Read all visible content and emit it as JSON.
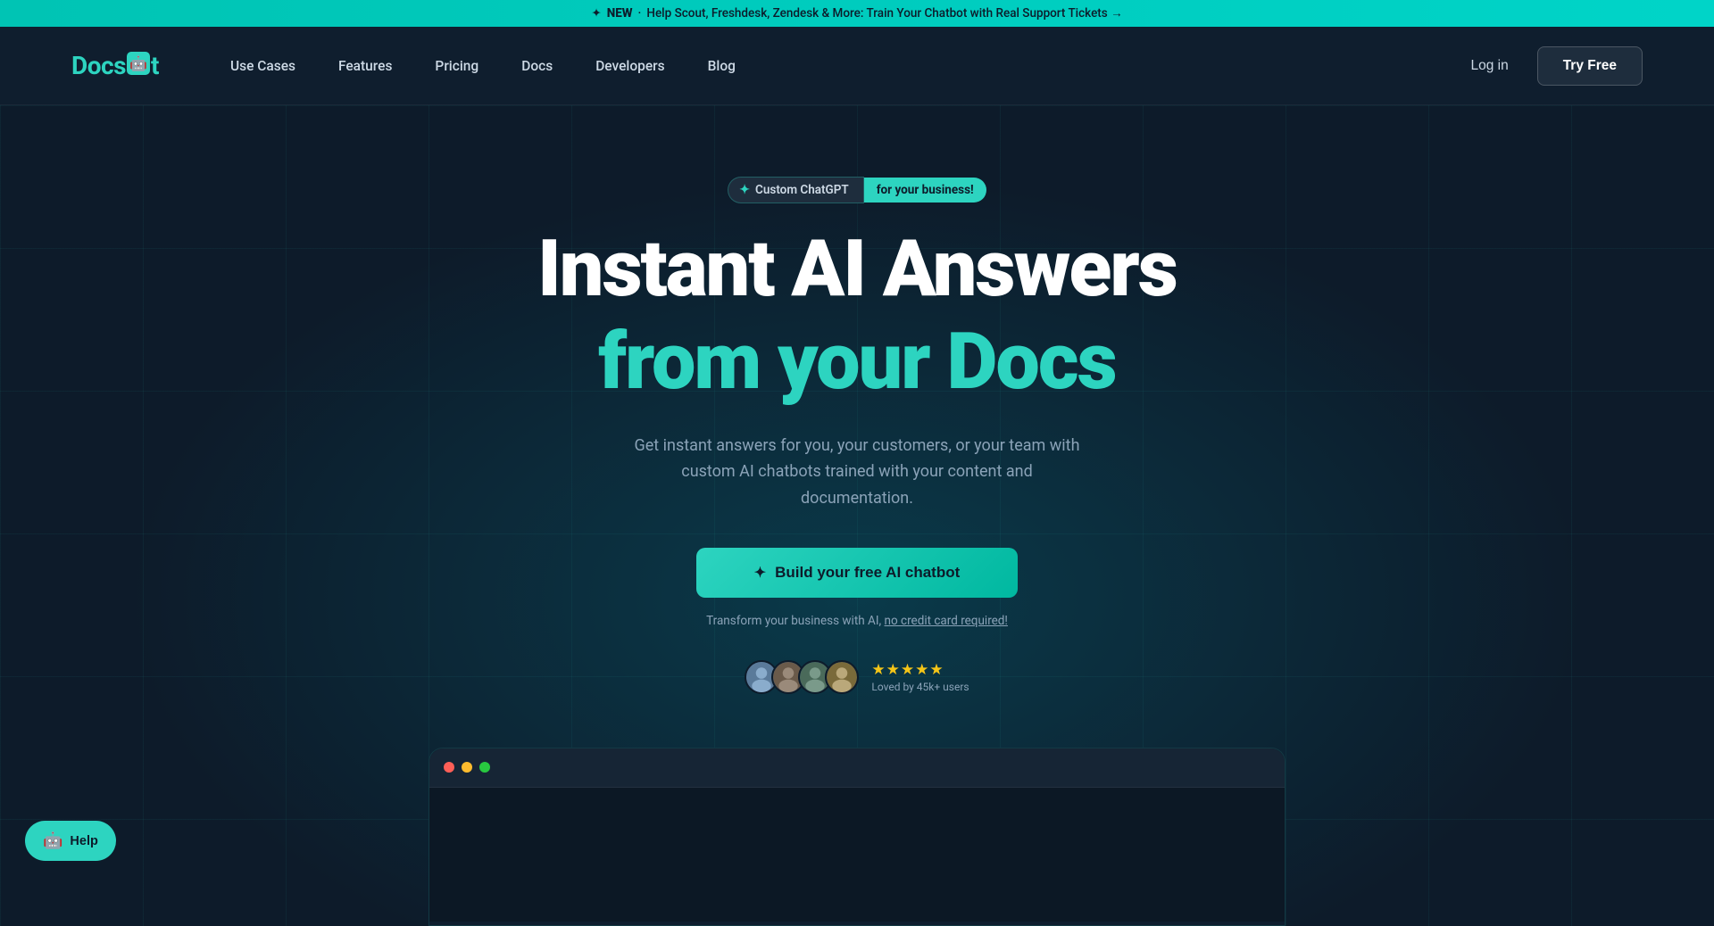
{
  "announcement": {
    "new_label": "NEW",
    "separator": "·",
    "text": "Help Scout, Freshdesk, Zendesk & More: Train Your Chatbot with Real Support Tickets →",
    "link_text": "Help Scout, Freshdesk, Zendesk & More: Train Your Chatbot with Real Support Tickets →"
  },
  "navbar": {
    "logo_text_before": "Docs",
    "logo_text_after": "t",
    "links": [
      {
        "label": "Use Cases",
        "id": "use-cases"
      },
      {
        "label": "Features",
        "id": "features"
      },
      {
        "label": "Pricing",
        "id": "pricing"
      },
      {
        "label": "Docs",
        "id": "docs"
      },
      {
        "label": "Developers",
        "id": "developers"
      },
      {
        "label": "Blog",
        "id": "blog"
      }
    ],
    "login_label": "Log in",
    "try_free_label": "Try Free"
  },
  "hero": {
    "badge_left": "Custom ChatGPT",
    "badge_right": "for your business!",
    "title_main": "Instant AI Answers",
    "title_sub": "from your Docs",
    "description": "Get instant answers for you, your customers, or your team with custom AI chatbots trained with your content and documentation.",
    "cta_label": "Build your free AI chatbot",
    "cta_sparkle": "✦",
    "cta_subtext_prefix": "Transform your business with AI,",
    "cta_subtext_link": "no credit card required!",
    "stars": "★★★★★",
    "rating_text": "Loved by 45k+ users"
  },
  "help_widget": {
    "label": "Help",
    "icon": "🤖"
  },
  "colors": {
    "teal": "#2dd4c0",
    "dark_bg": "#0d1b2a",
    "nav_bg": "#0f1e2e"
  }
}
